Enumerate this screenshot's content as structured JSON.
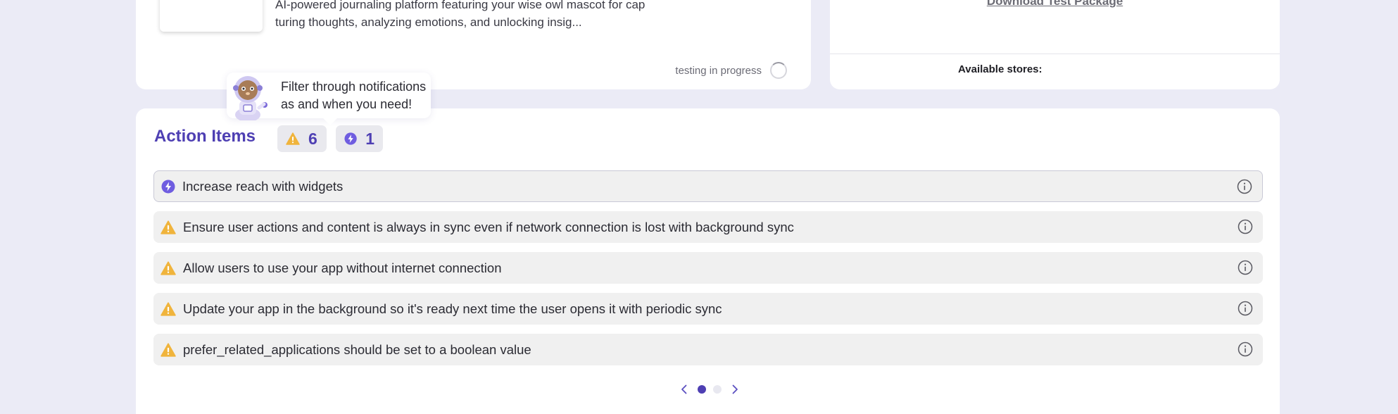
{
  "app_card": {
    "description": "AI-powered journaling platform featuring your wise owl mascot for cap turing thoughts, analyzing emotions, and unlocking insig...",
    "status": "testing in progress"
  },
  "package_card": {
    "download_link": "Download Test Package",
    "stores_label": "Available stores:"
  },
  "tooltip": {
    "text": "Filter through notifications as and when you need!"
  },
  "action_items": {
    "title": "Action Items",
    "warning_count": "6",
    "feature_count": "1",
    "items": [
      {
        "type": "feature",
        "label": "Increase reach with widgets"
      },
      {
        "type": "warning",
        "label": "Ensure user actions and content is always in sync even if network connection is lost with background sync"
      },
      {
        "type": "warning",
        "label": "Allow users to use your app without internet connection"
      },
      {
        "type": "warning",
        "label": "Update your app in the background so it's ready next time the user opens it with periodic sync"
      },
      {
        "type": "warning",
        "label": "prefer_related_applications should be set to a boolean value"
      }
    ],
    "pagination": {
      "current_page": 1,
      "total_pages": 2
    }
  },
  "colors": {
    "accent": "#4e3fb3",
    "warning": "#f0b43c",
    "feature": "#6f5de0",
    "page_background": "#ebebf6"
  }
}
